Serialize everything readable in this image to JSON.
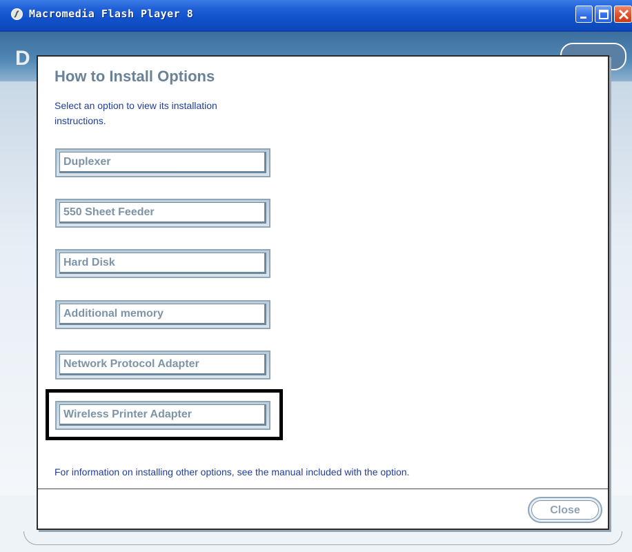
{
  "window": {
    "title": "Macromedia Flash Player 8",
    "accent_color": "#1152cc",
    "controls": {
      "minimize_icon": "minimize-icon",
      "maximize_icon": "maximize-icon",
      "close_icon": "close-x-icon"
    }
  },
  "dialog": {
    "title": "How to Install Options",
    "description": "Select an option to view its installation instructions.",
    "options": [
      {
        "label": "Duplexer"
      },
      {
        "label": "550 Sheet Feeder"
      },
      {
        "label": "Hard Disk"
      },
      {
        "label": "Additional memory"
      },
      {
        "label": "Network Protocol Adapter"
      },
      {
        "label": "Wireless Printer Adapter",
        "highlighted": true
      }
    ],
    "footer_note": "For information on installing other options, see the manual included with the option.",
    "close_label": "Close"
  }
}
